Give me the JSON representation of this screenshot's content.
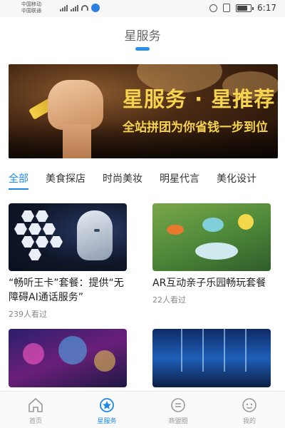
{
  "status_bar": {
    "carrier_1": "中国移动",
    "carrier_2": "中国联通",
    "time": "6:17"
  },
  "header": {
    "title": "星服务"
  },
  "banner": {
    "headline": "星服务 · 星推荐",
    "subline": "全站拼团为你省钱一步到位"
  },
  "tabs": [
    {
      "label": "全部",
      "active": true
    },
    {
      "label": "美食探店",
      "active": false
    },
    {
      "label": "时尚美妆",
      "active": false
    },
    {
      "label": "明星代言",
      "active": false
    },
    {
      "label": "美化设计",
      "active": false
    }
  ],
  "cards": [
    {
      "title": "“畅听王卡”套餐：提供“无障碍AI通话服务”",
      "views": "239人看过"
    },
    {
      "title": "AR互动亲子乐园畅玩套餐",
      "views": "22人看过"
    },
    {
      "title": "",
      "views": ""
    },
    {
      "title": "",
      "views": ""
    }
  ],
  "bottom_nav": [
    {
      "label": "首页",
      "icon": "home-icon",
      "active": false
    },
    {
      "label": "星服务",
      "icon": "star-service-icon",
      "active": true
    },
    {
      "label": "商盟圈",
      "icon": "business-circle-icon",
      "active": false
    },
    {
      "label": "我的",
      "icon": "profile-icon",
      "active": false
    }
  ],
  "colors": {
    "accent": "#1e88e5",
    "banner_text": "#f6d34e"
  }
}
